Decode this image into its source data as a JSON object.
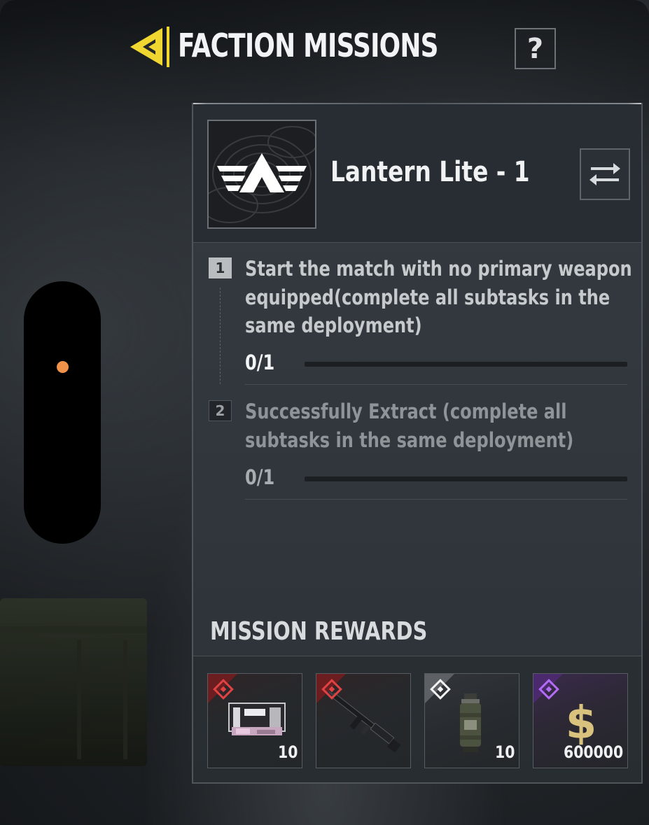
{
  "header": {
    "title": "FACTION MISSIONS",
    "help_label": "?"
  },
  "mission": {
    "name": "Lantern Lite - 1",
    "tasks": [
      {
        "number": "1",
        "text": "Start the match with no primary weapon equipped(complete all subtasks in the same deployment)",
        "progress_text": "0/1",
        "progress": 0,
        "state": "active"
      },
      {
        "number": "2",
        "text": "Successfully Extract (complete all subtasks in the same deployment)",
        "progress_text": "0/1",
        "progress": 0,
        "state": "inactive"
      }
    ]
  },
  "rewards": {
    "title": "MISSION REWARDS",
    "items": [
      {
        "icon": "weapon-case-icon",
        "rarity": "red",
        "quantity": "10"
      },
      {
        "icon": "assault-rifle-icon",
        "rarity": "red",
        "quantity": ""
      },
      {
        "icon": "grenade-icon",
        "rarity": "white",
        "quantity": "10"
      },
      {
        "icon": "cash-icon",
        "rarity": "purple",
        "quantity": "600000"
      }
    ]
  },
  "colors": {
    "accent_yellow": "#f0d630",
    "rarity_red": "#d6393a",
    "rarity_white": "#e8e8e8",
    "rarity_purple": "#a259e6",
    "indicator_orange": "#f0924a"
  }
}
